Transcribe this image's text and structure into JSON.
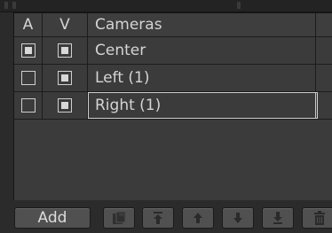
{
  "header": {
    "col_a": "A",
    "col_v": "V",
    "col_name": "Cameras"
  },
  "rows": [
    {
      "name": "Center",
      "a_checked": true,
      "v_checked": true,
      "selected": false
    },
    {
      "name": "Left (1)",
      "a_checked": false,
      "v_checked": true,
      "selected": false
    },
    {
      "name": "Right (1)",
      "a_checked": false,
      "v_checked": true,
      "selected": true
    }
  ],
  "toolbar": {
    "add_label": "Add",
    "icons": [
      "copy-icon",
      "move-to-top-icon",
      "move-up-icon",
      "move-down-icon",
      "move-to-bottom-icon",
      "trash-icon"
    ]
  },
  "colors": {
    "panel_bg": "#3b3b3b",
    "app_bg": "#2b2b2b",
    "button_bg": "#505050",
    "text": "#d6d6d6"
  }
}
